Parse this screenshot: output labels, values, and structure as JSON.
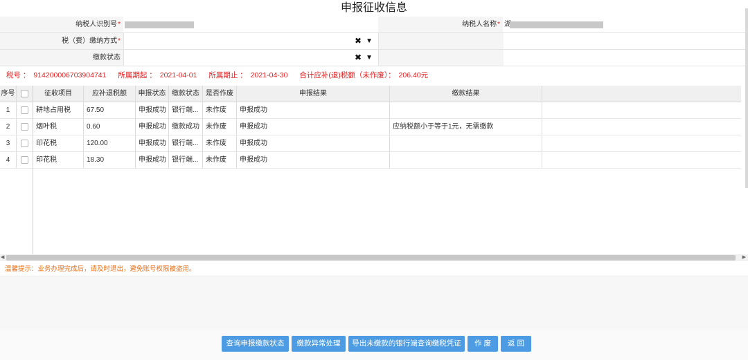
{
  "page": {
    "title": "申报征收信息"
  },
  "form": {
    "taxpayer_id_label": "纳税人识别号",
    "taxpayer_name_label": "纳税人名称",
    "taxpayer_name_prefix": "湖",
    "payment_method_label": "税（费）缴纳方式",
    "payment_status_label": "缴款状态",
    "required_mark": "*",
    "clear_glyph": "✖",
    "chevron_glyph": "⌄"
  },
  "summary": {
    "tax_no_label": "税号 ：",
    "tax_no": "914200006703904741",
    "period_start_label": "所属期起 ：",
    "period_start": "2021-04-01",
    "period_end_label": "所属期止 ：",
    "period_end": "2021-04-30",
    "total_label": "合计应补(退)税额（未作废）：",
    "total_value": "206.40元"
  },
  "table": {
    "headers": {
      "seq": "序号",
      "item": "征收项目",
      "amount": "应补退税额",
      "declare_status": "申报状态",
      "payment_status": "缴款状态",
      "voided": "是否作废",
      "declare_result": "申报结果",
      "payment_result": "缴款结果"
    },
    "rows": [
      {
        "seq": "1",
        "item": "耕地占用税",
        "amount": "67.50",
        "declare_status": "申报成功",
        "payment_status": "银行端...",
        "voided": "未作废",
        "declare_result": "申报成功",
        "payment_result": ""
      },
      {
        "seq": "2",
        "item": "烟叶税",
        "amount": "0.60",
        "declare_status": "申报成功",
        "payment_status": "缴款成功",
        "voided": "未作废",
        "declare_result": "申报成功",
        "payment_result": "应纳税额小于等于1元，无需缴款"
      },
      {
        "seq": "3",
        "item": "印花税",
        "amount": "120.00",
        "declare_status": "申报成功",
        "payment_status": "银行端...",
        "voided": "未作废",
        "declare_result": "申报成功",
        "payment_result": ""
      },
      {
        "seq": "4",
        "item": "印花税",
        "amount": "18.30",
        "declare_status": "申报成功",
        "payment_status": "银行端...",
        "voided": "未作废",
        "declare_result": "申报成功",
        "payment_result": ""
      }
    ]
  },
  "tip": "温馨提示：业务办理完成后，请及时退出，避免账号权限被盗用。",
  "buttons": {
    "query_status": "查询申报缴款状态",
    "payment_exception": "缴款异常处理",
    "export_voucher": "导出未缴款的银行端查询缴税凭证",
    "void": "作 废",
    "back": "返 回"
  },
  "colors": {
    "accent": "#4d9be2",
    "warning": "#e02020",
    "tip": "#e8701a"
  }
}
